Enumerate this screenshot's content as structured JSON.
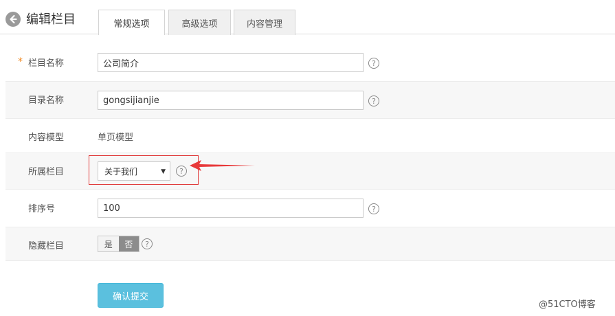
{
  "header": {
    "title": "编辑栏目",
    "tabs": [
      {
        "label": "常规选项",
        "active": true
      },
      {
        "label": "高级选项",
        "active": false
      },
      {
        "label": "内容管理",
        "active": false
      }
    ]
  },
  "form": {
    "column_name": {
      "label": "栏目名称",
      "required_mark": "*",
      "value": "公司简介"
    },
    "directory_name": {
      "label": "目录名称",
      "value": "gongsijianjie"
    },
    "content_model": {
      "label": "内容模型",
      "value": "单页模型"
    },
    "parent_column": {
      "label": "所属栏目",
      "selected": "关于我们"
    },
    "sort_number": {
      "label": "排序号",
      "value": "100"
    },
    "hidden_column": {
      "label": "隐藏栏目",
      "yes_label": "是",
      "no_label": "否",
      "selected": "否"
    },
    "help_glyph": "?"
  },
  "submit_label": "确认提交",
  "watermark": "@51CTO博客",
  "colors": {
    "accent_button": "#5bc0de",
    "highlight_border": "#e03a3a",
    "arrow": "#e8393a",
    "required_star": "#f08a24"
  },
  "icons": [
    "back-arrow-icon",
    "question-circle-icon",
    "caret-down-icon",
    "red-pointer-arrow"
  ]
}
